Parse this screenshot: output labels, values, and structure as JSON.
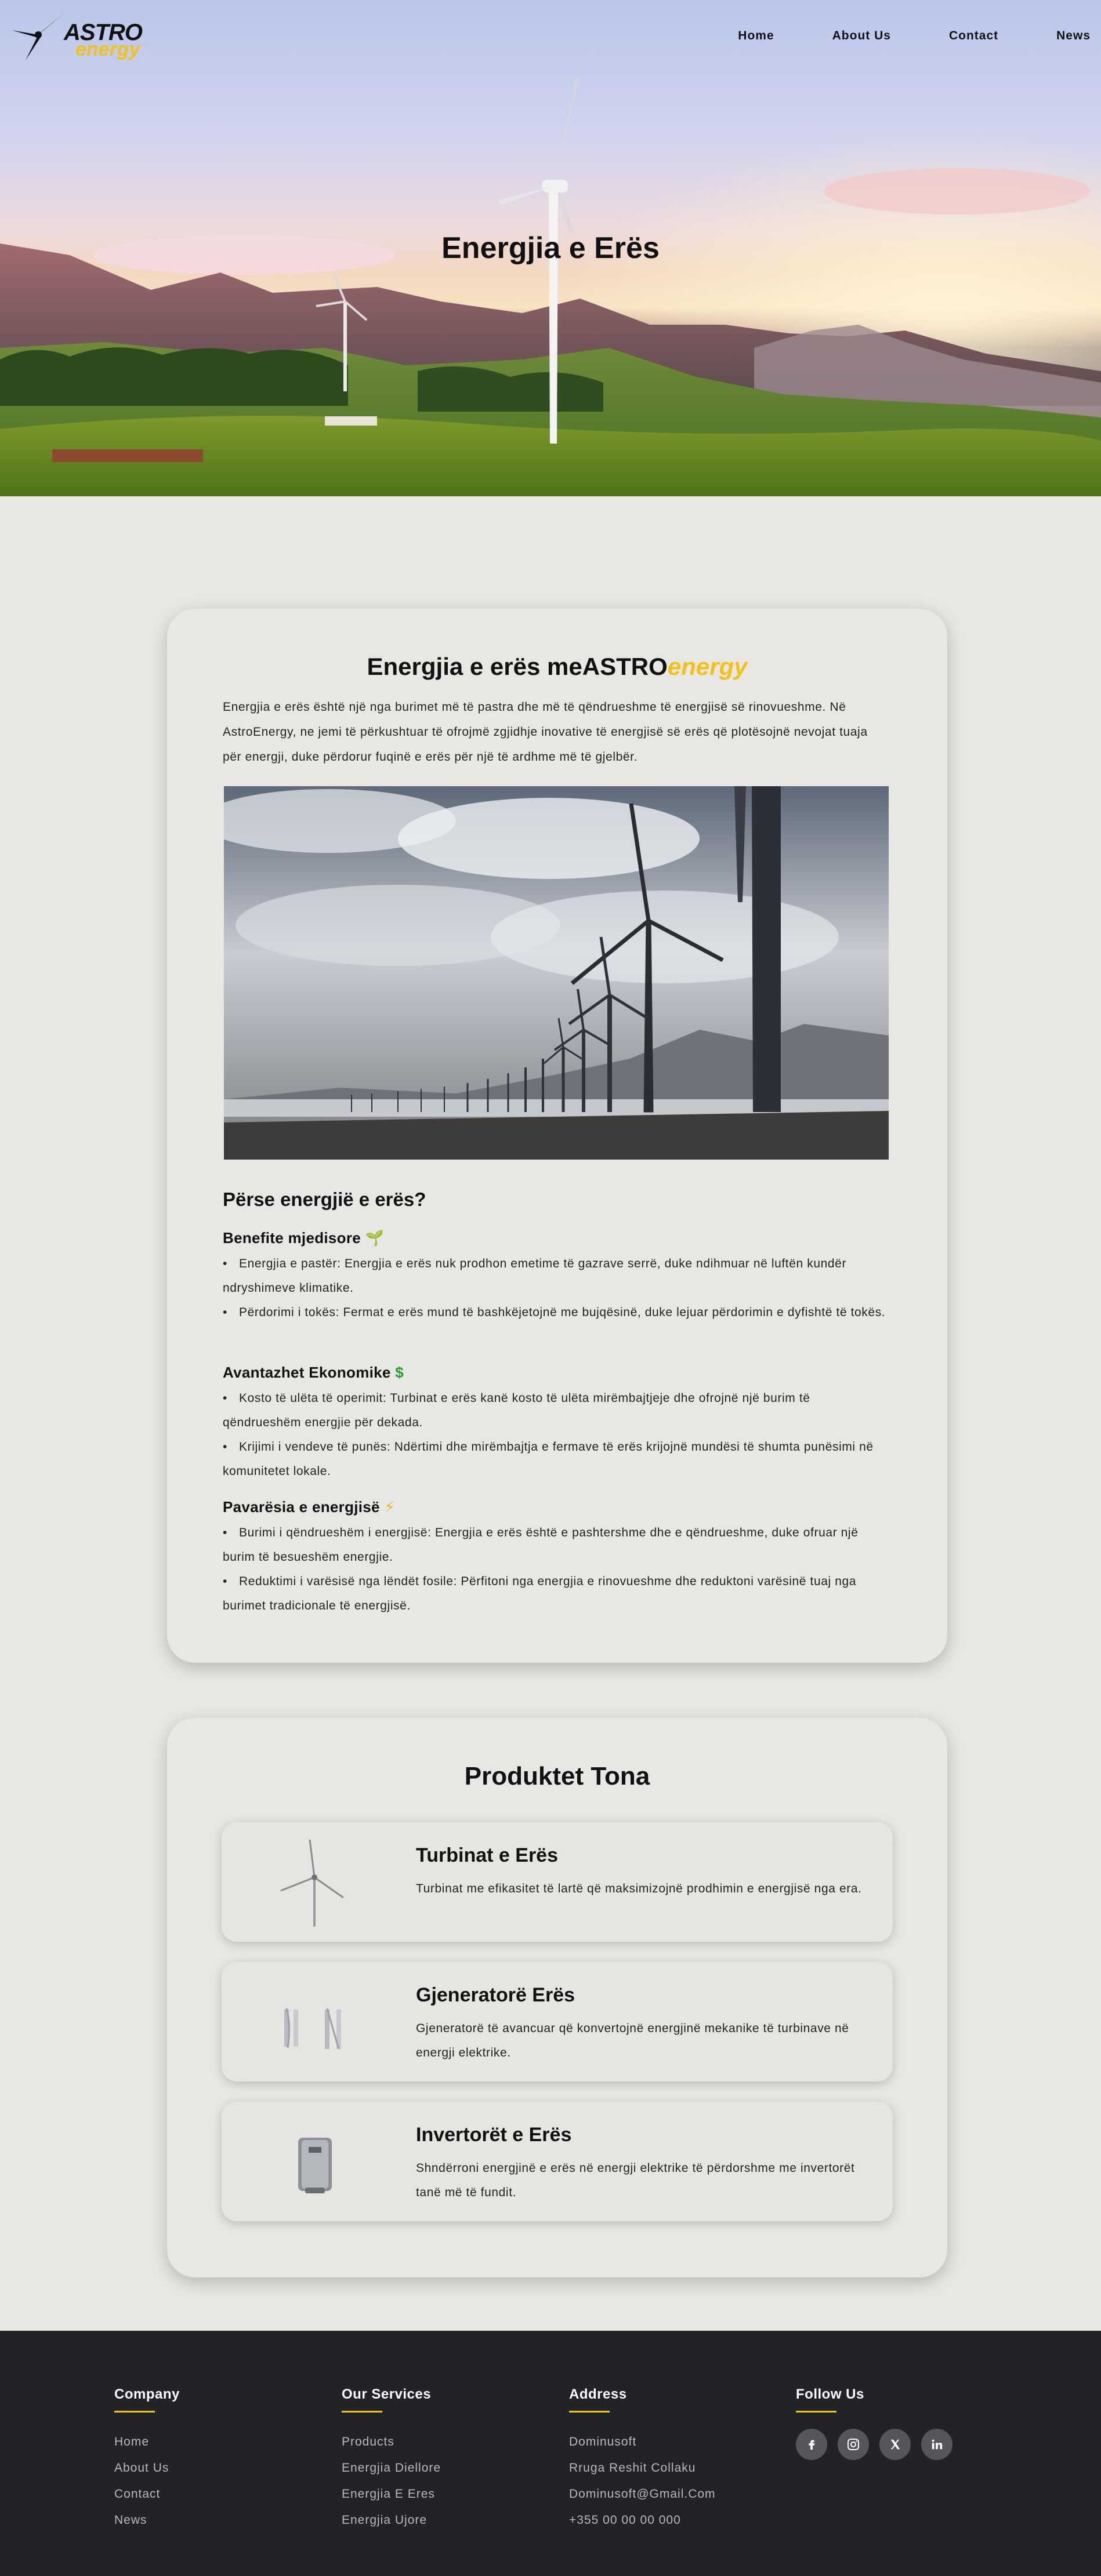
{
  "header": {
    "logo_main": "ASTRO",
    "logo_sub": "energy",
    "nav": [
      "Home",
      "About Us",
      "Contact",
      "News"
    ]
  },
  "hero": {
    "title": "Energjia e Erës"
  },
  "info": {
    "title_prefix": "Energjia e erës me",
    "title_brand": "ASTRO",
    "title_accent": "energy",
    "intro": "Energjia e erës është një nga burimet më të pastra dhe më të qëndrueshme të energjisë së rinovueshme. Në AstroEnergy, ne jemi të përkushtuar të ofrojmë zgjidhje inovative të energjisë së erës që plotësojnë nevojat tuaja për energji, duke përdorur fuqinë e erës për një të ardhme më të gjelbër.",
    "why_heading": "Përse energjië e erës?",
    "sections": [
      {
        "heading": "Benefite mjedisore",
        "emoji": "🌱",
        "items": [
          "Energjia e pastër: Energjia e erës nuk prodhon emetime të gazrave serrë, duke ndihmuar në luftën kundër ndryshimeve klimatike.",
          "Përdorimi i tokës: Fermat e erës mund të bashkëjetojnë me bujqësinë, duke lejuar përdorimin e dyfishtë të tokës."
        ]
      },
      {
        "heading": "Avantazhet Ekonomike",
        "emoji": "$",
        "items": [
          "Kosto të ulëta të operimit: Turbinat e erës kanë kosto të ulëta mirëmbajtjeje dhe ofrojnë një burim të qëndrueshëm energjie për dekada.",
          "Krijimi i vendeve të punës: Ndërtimi dhe mirëmbajtja e fermave të erës krijojnë mundësi të shumta punësimi në komunitetet lokale."
        ]
      },
      {
        "heading": "Pavarësia e energjisë",
        "emoji": "⚡",
        "items": [
          "Burimi i qëndrueshëm i energjisë: Energjia e erës është e pashtershme dhe e qëndrueshme, duke ofruar një burim të besueshëm energjie.",
          "Reduktimi i varësisë nga lëndët fosile: Përfitoni nga energjia e rinovueshme dhe reduktoni varësinë tuaj nga burimet tradicionale të energjisë."
        ]
      }
    ]
  },
  "products": {
    "title": "Produktet Tona",
    "items": [
      {
        "name": "Turbinat e Erës",
        "desc": "Turbinat me efikasitet të lartë që maksimizojnë prodhimin e energjisë nga era."
      },
      {
        "name": "Gjeneratorë Erës",
        "desc": "Gjeneratorë të avancuar që konvertojnë energjinë mekanike të turbinave në energji elektrike."
      },
      {
        "name": "Invertorët e Erës",
        "desc": "Shndërroni energjinë e erës në energji elektrike të përdorshme me invertorët tanë më të fundit."
      }
    ]
  },
  "footer": {
    "company": {
      "title": "Company",
      "links": [
        "Home",
        "About Us",
        "Contact",
        "News"
      ]
    },
    "services": {
      "title": "Our Services",
      "links": [
        "Products",
        "Energjia Diellore",
        "Energjia E Eres",
        "Energjia Ujore"
      ]
    },
    "address": {
      "title": "Address",
      "lines": [
        "Dominusoft",
        "Rruga Reshit Collaku",
        "Dominusoft@Gmail.Com",
        "+355 00 00 00 000"
      ]
    },
    "follow": {
      "title": "Follow Us",
      "icons": [
        "facebook-icon",
        "instagram-icon",
        "x-icon",
        "linkedin-icon"
      ]
    }
  },
  "colors": {
    "accent": "#f2c21a",
    "footer_bg": "#222327",
    "page_bg": "#e8e7e4"
  }
}
